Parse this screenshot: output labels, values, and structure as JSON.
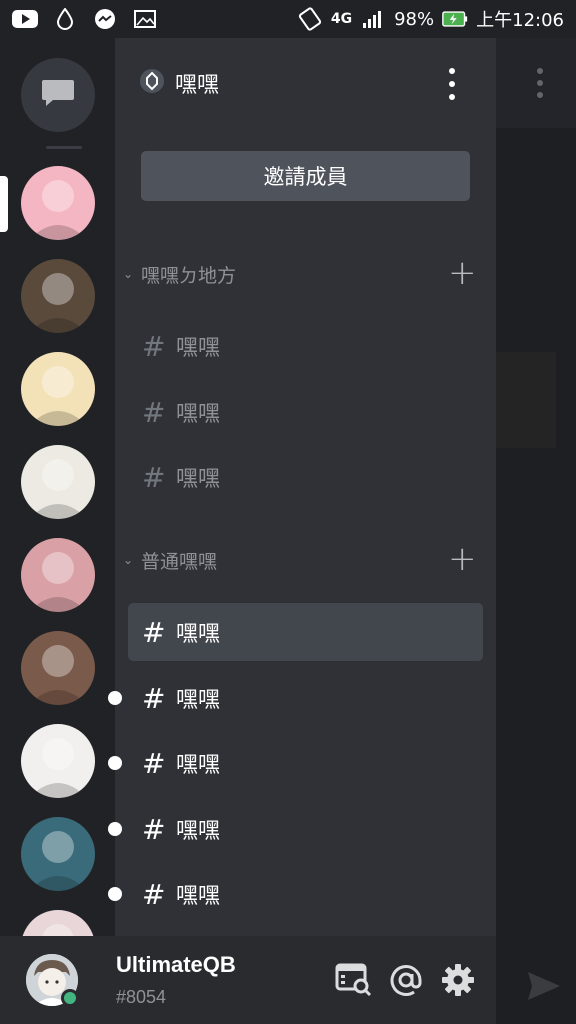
{
  "status_bar": {
    "battery_percent": "98%",
    "time": "上午12:06",
    "network": "4G",
    "left_icons": [
      "youtube-icon",
      "droplet-icon",
      "messenger-icon",
      "gallery-icon"
    ],
    "right_icons": [
      "rotate-icon",
      "network-4g-icon",
      "signal-icon",
      "battery-icon"
    ]
  },
  "rail": {
    "dm_icon": "chat-bubble-icon",
    "servers": [
      {
        "name": "server-1",
        "color": "#f4b6c2",
        "selected": true
      },
      {
        "name": "server-2",
        "color": "#5a4a3c"
      },
      {
        "name": "server-3",
        "color": "#f3e2b8"
      },
      {
        "name": "server-4",
        "color": "#eceae2"
      },
      {
        "name": "server-5",
        "color": "#d9a0a6"
      },
      {
        "name": "server-6",
        "color": "#7a5a4a"
      },
      {
        "name": "server-7",
        "color": "#f2f0ee"
      },
      {
        "name": "server-8",
        "color": "#3a6b7a"
      },
      {
        "name": "server-9",
        "color": "#e8d6d8"
      }
    ]
  },
  "guild": {
    "name": "嘿嘿",
    "invite_label": "邀請成員"
  },
  "categories": [
    {
      "name": "嘿嘿ㄉ地方",
      "channels": [
        {
          "name": "嘿嘿"
        },
        {
          "name": "嘿嘿"
        },
        {
          "name": "嘿嘿"
        }
      ]
    },
    {
      "name": "普通嘿嘿",
      "channels": [
        {
          "name": "嘿嘿",
          "selected": true
        },
        {
          "name": "嘿嘿",
          "unread": true
        },
        {
          "name": "嘿嘿",
          "unread": true
        },
        {
          "name": "嘿嘿",
          "unread": true
        },
        {
          "name": "嘿嘿",
          "unread": true
        }
      ]
    }
  ],
  "user": {
    "username": "UltimateQB",
    "discriminator": "#8054",
    "status": "online",
    "status_color": "#43b581"
  },
  "colors": {
    "accent_background": "#2f3136",
    "rail_background": "#202225",
    "selected_channel": "#42464d",
    "invite_button": "#4f545c"
  }
}
